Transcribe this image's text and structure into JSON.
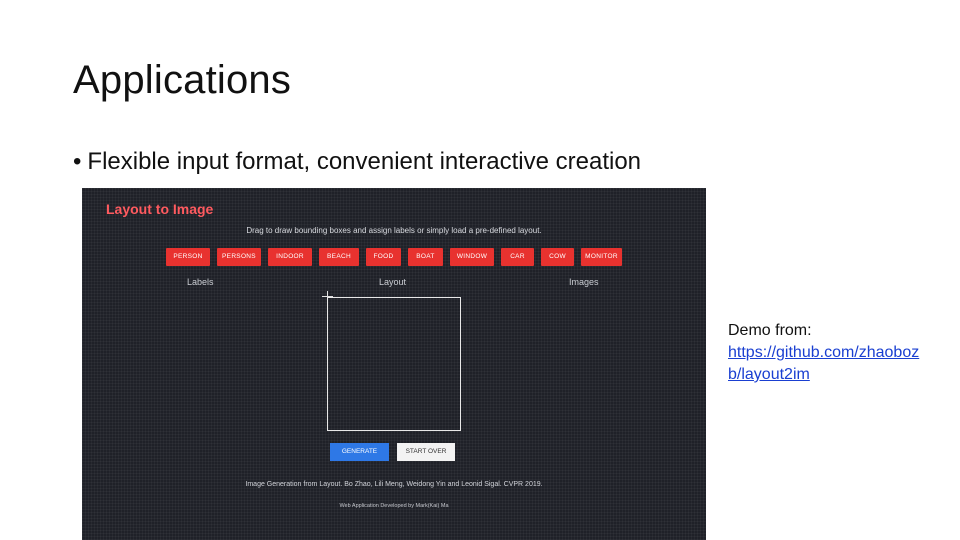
{
  "slide": {
    "title": "Applications",
    "bullet": "Flexible input format, convenient interactive creation",
    "bullet_symbol": "•"
  },
  "demo": {
    "app_title": "Layout to Image",
    "instructions": "Drag to draw bounding boxes and assign labels or simply load a pre-defined layout.",
    "labels": [
      "PERSON",
      "PERSONS",
      "INDOOR",
      "BEACH",
      "FOOD",
      "BOAT",
      "WINDOW",
      "CAR",
      "COW",
      "MONITOR"
    ],
    "columns": {
      "labels": "Labels",
      "layout": "Layout",
      "images": "Images"
    },
    "buttons": {
      "generate": "GENERATE",
      "start_over": "START OVER"
    },
    "citation": "Image Generation from Layout. Bo Zhao, Lili Meng, Weidong Yin and Leonid Sigal. CVPR 2019.",
    "credit": "Web Application Developed by Mark(Kai) Ma"
  },
  "side_note": {
    "prefix": "Demo from:",
    "link": "https://github.com/zhaoboz b/layout2im"
  },
  "colors": {
    "demo_background": "#1f2128",
    "accent_red": "#e8322f",
    "title_red": "#ff5a5f",
    "generate_blue": "#2e78e6",
    "link_blue": "#1a3fd1"
  }
}
